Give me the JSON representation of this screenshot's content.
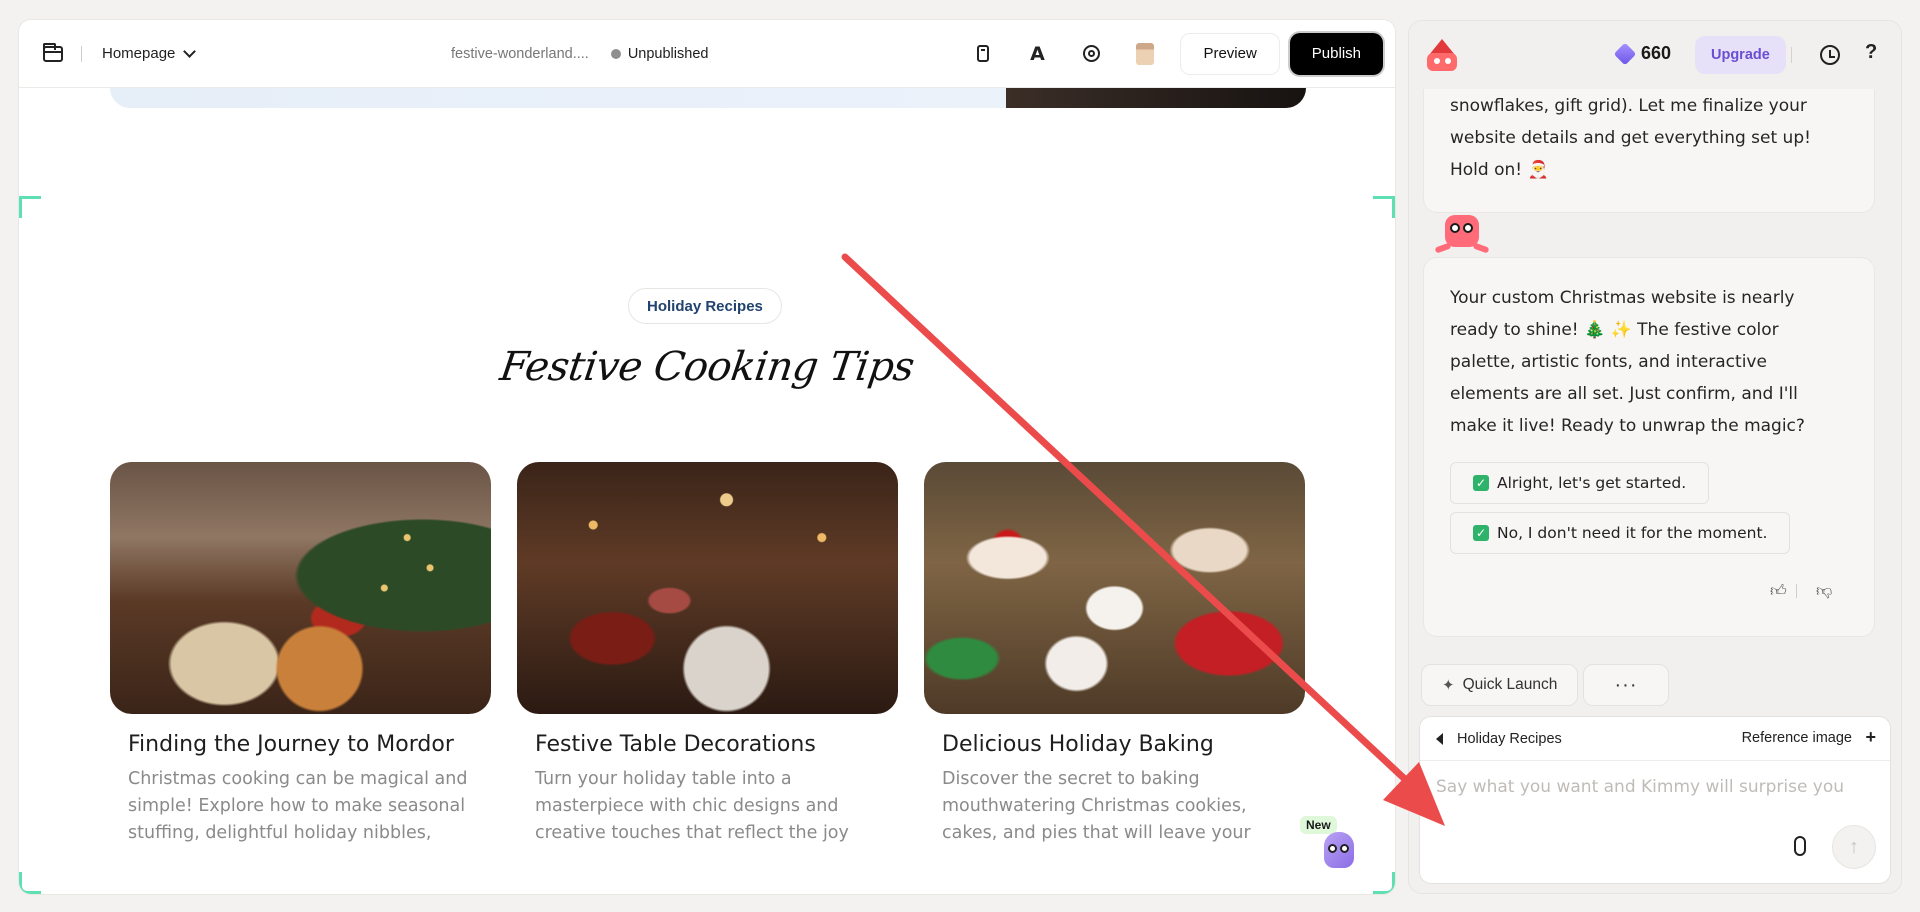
{
  "editor": {
    "page_select": "Homepage",
    "site_name": "festive-wonderland....",
    "status": "Unpublished",
    "preview_label": "Preview",
    "publish_label": "Publish"
  },
  "section": {
    "badge": "Holiday Recipes",
    "title": "Festive Cooking Tips",
    "cards": [
      {
        "title": "Finding the Journey to Mordor",
        "desc": "Christmas cooking can be magical and simple! Explore how to make seasonal stuffing, delightful holiday nibbles, and..."
      },
      {
        "title": "Festive Table Decorations",
        "desc": "Turn your holiday table into a masterpiece with chic designs and creative touches that reflect the joy of..."
      },
      {
        "title": "Delicious Holiday Baking",
        "desc": "Discover the secret to baking mouthwatering Christmas cookies, cakes, and pies that will leave your family and..."
      }
    ],
    "new_badge": "New"
  },
  "chat": {
    "credits": "660",
    "upgrade_label": "Upgrade",
    "help_label": "?",
    "msg1": "snowflakes, gift grid). Let me finalize your website details and get everything set up! Hold on! 🎅",
    "msg2": "Your custom Christmas website is nearly ready to shine! 🎄 ✨ The festive color palette, artistic fonts, and interactive elements are all set. Just confirm, and I'll make it live! Ready to unwrap the magic?",
    "option1": "Alright, let's get started.",
    "option2": "No, I don't need it for the moment.",
    "quick_launch": "Quick Launch",
    "more": "···",
    "composer": {
      "context": "Holiday Recipes",
      "reference_image": "Reference image",
      "plus": "+",
      "placeholder": "Say what you want and Kimmy will surprise you"
    }
  },
  "colors": {
    "accent_purple": "#6a4fd2",
    "publish_bg": "#000000",
    "selection_corner": "#5fe0b4",
    "annotation_arrow": "#ec4b4b"
  }
}
